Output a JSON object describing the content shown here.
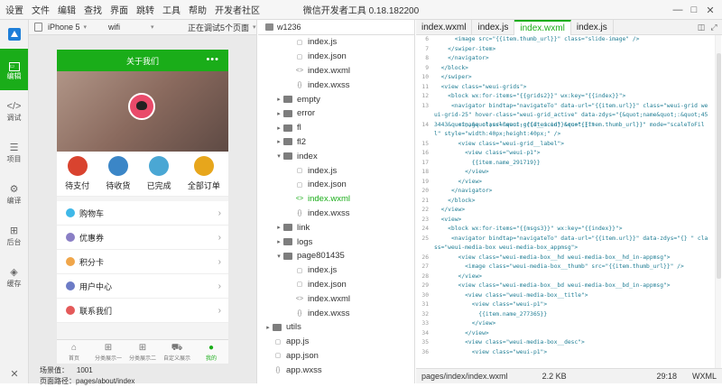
{
  "menu": [
    "设置",
    "文件",
    "编辑",
    "查找",
    "界面",
    "跳转",
    "工具",
    "帮助",
    "开发者社区"
  ],
  "app_title": "微信开发者工具 0.18.182200",
  "left_nav": [
    {
      "label": "编辑",
      "icon": "edit-icon"
    },
    {
      "label": "调试",
      "icon": "code-icon"
    },
    {
      "label": "项目",
      "icon": "menu-icon"
    },
    {
      "label": "编译",
      "icon": "compile-icon"
    },
    {
      "label": "后台",
      "icon": "backend-icon"
    },
    {
      "label": "缓存",
      "icon": "cache-icon"
    }
  ],
  "simulator": {
    "device": "iPhone 5",
    "network": "wifi",
    "debug_status": "正在调试5个页面",
    "scene_label": "场景值：",
    "scene_value": "1001",
    "path_label": "页面路径：",
    "path_value": "pages/about/index"
  },
  "phone": {
    "nav_title": "关于我们",
    "nav_dots": "•••",
    "orders": [
      {
        "label": "待支付",
        "color": "#d9432f"
      },
      {
        "label": "待收货",
        "color": "#3b86c7"
      },
      {
        "label": "已完成",
        "color": "#4aa7d4"
      },
      {
        "label": "全部订单",
        "color": "#e7a61c"
      }
    ],
    "list": [
      {
        "label": "购物车",
        "color": "#3fb8e8"
      },
      {
        "label": "优惠券",
        "color": "#8a7fc5"
      },
      {
        "label": "积分卡",
        "color": "#f0a64a"
      },
      {
        "label": "用户中心",
        "color": "#6c7bc6"
      },
      {
        "label": "联系我们",
        "color": "#e45a5a"
      }
    ],
    "tabs": [
      {
        "label": "首页",
        "icon": "home-icon"
      },
      {
        "label": "分类展示一",
        "icon": "grid-icon"
      },
      {
        "label": "分类展示二",
        "icon": "grid-icon"
      },
      {
        "label": "自定义展示",
        "icon": "cart-icon"
      },
      {
        "label": "我的",
        "icon": "user-icon"
      }
    ]
  },
  "tree": {
    "root": "w1236",
    "rows": [
      {
        "name": "index.js",
        "type": "js",
        "indent": 2
      },
      {
        "name": "index.json",
        "type": "json",
        "indent": 2
      },
      {
        "name": "index.wxml",
        "type": "wxml",
        "indent": 2
      },
      {
        "name": "index.wxss",
        "type": "wxss",
        "indent": 2
      },
      {
        "name": "empty",
        "type": "folder",
        "indent": 1,
        "arrow": "▸"
      },
      {
        "name": "error",
        "type": "folder",
        "indent": 1,
        "arrow": "▸"
      },
      {
        "name": "fl",
        "type": "folder",
        "indent": 1,
        "arrow": "▸"
      },
      {
        "name": "fl2",
        "type": "folder",
        "indent": 1,
        "arrow": "▸"
      },
      {
        "name": "index",
        "type": "folder",
        "indent": 1,
        "arrow": "▾"
      },
      {
        "name": "index.js",
        "type": "js",
        "indent": 2
      },
      {
        "name": "index.json",
        "type": "json",
        "indent": 2
      },
      {
        "name": "index.wxml",
        "type": "wxml",
        "indent": 2,
        "selected": true
      },
      {
        "name": "index.wxss",
        "type": "wxss",
        "indent": 2
      },
      {
        "name": "link",
        "type": "folder",
        "indent": 1,
        "arrow": "▸"
      },
      {
        "name": "logs",
        "type": "folder",
        "indent": 1,
        "arrow": "▸"
      },
      {
        "name": "page801435",
        "type": "folder",
        "indent": 1,
        "arrow": "▾"
      },
      {
        "name": "index.js",
        "type": "js",
        "indent": 2
      },
      {
        "name": "index.json",
        "type": "json",
        "indent": 2
      },
      {
        "name": "index.wxml",
        "type": "wxml",
        "indent": 2
      },
      {
        "name": "index.wxss",
        "type": "wxss",
        "indent": 2
      },
      {
        "name": "utils",
        "type": "folder",
        "indent": 0,
        "arrow": "▸"
      },
      {
        "name": "app.js",
        "type": "js",
        "indent": 0
      },
      {
        "name": "app.json",
        "type": "json",
        "indent": 0
      },
      {
        "name": "app.wxss",
        "type": "wxss",
        "indent": 0
      }
    ]
  },
  "editor": {
    "tabs": [
      "index.wxml",
      "index.js",
      "index.wxml",
      "index.js"
    ],
    "active_tab": 2,
    "lines": [
      {
        "n": "6",
        "t": "      <image src=\"{{item.thumb_url}}\" class=\"slide-image\" />"
      },
      {
        "n": "7",
        "t": "    </swiper-item>"
      },
      {
        "n": "8",
        "t": "    </navigator>"
      },
      {
        "n": "9",
        "t": "  </block>"
      },
      {
        "n": "10",
        "t": "  </swiper>"
      },
      {
        "n": "11",
        "t": "  <view class=\"weui-grids\">"
      },
      {
        "n": "12",
        "t": "    <block wx:for-items=\"{{grids2}}\" wx:key=\"{{index}}\">"
      },
      {
        "n": "13",
        "t": "     <navigator bindtap=\"navigateTo\" data-url=\"{{item.url}}\" class=\"weui-grid weui-grid-25\" hover-class=\"weui-grid_active\" data-zdys=\"{&quot;name&quot;:&quot;453443&quot;,&quot;url&quot;:{{item.id}}&quot;}\">",
        "wrap": true
      },
      {
        "n": "14",
        "t": "       <image class=\"weui-grid__icon\" src=\"{{item.thumb_url}}\" mode=\"scaleToFill\" style=\"width:40px;height:40px;\" />",
        "wrap": true
      },
      {
        "n": "15",
        "t": "       <view class=\"weui-grid__label\">"
      },
      {
        "n": "16",
        "t": "         <view class=\"weui-p1\">"
      },
      {
        "n": "17",
        "t": "           {{item.name_291719}}"
      },
      {
        "n": "18",
        "t": "         </view>"
      },
      {
        "n": "19",
        "t": "       </view>"
      },
      {
        "n": "20",
        "t": "     </navigator>"
      },
      {
        "n": "21",
        "t": "    </block>"
      },
      {
        "n": "22",
        "t": "  </view>"
      },
      {
        "n": "23",
        "t": "  <view>"
      },
      {
        "n": "24",
        "t": "    <block wx:for-items=\"{{msgs3}}\" wx:key=\"{{index}}\">"
      },
      {
        "n": "25",
        "t": "     <navigator bindtap=\"navigateTo\" data-url=\"{{item.url}}\" data-zdys=\"{} \" class=\"weui-media-box weui-media-box_appmsg\">",
        "wrap": true
      },
      {
        "n": "26",
        "t": "       <view class=\"weui-media-box__hd weui-media-box__hd_in-appmsg\">"
      },
      {
        "n": "27",
        "t": "         <image class=\"weui-media-box__thumb\" src=\"{{item.thumb_url}}\" />"
      },
      {
        "n": "28",
        "t": "       </view>"
      },
      {
        "n": "29",
        "t": "       <view class=\"weui-media-box__bd weui-media-box__bd_in-appmsg\">"
      },
      {
        "n": "30",
        "t": "         <view class=\"weui-media-box__title\">"
      },
      {
        "n": "31",
        "t": "           <view class=\"weui-p1\">"
      },
      {
        "n": "32",
        "t": "             {{item.name_277365}}"
      },
      {
        "n": "33",
        "t": "           </view>"
      },
      {
        "n": "34",
        "t": "         </view>"
      },
      {
        "n": "35",
        "t": "         <view class=\"weui-media-box__desc\">"
      },
      {
        "n": "36",
        "t": "           <view class=\"weui-p1\">"
      }
    ],
    "status": {
      "path": "pages/index/index.wxml",
      "size": "2.2 KB",
      "cursor": "29:18",
      "language": "WXML"
    }
  }
}
